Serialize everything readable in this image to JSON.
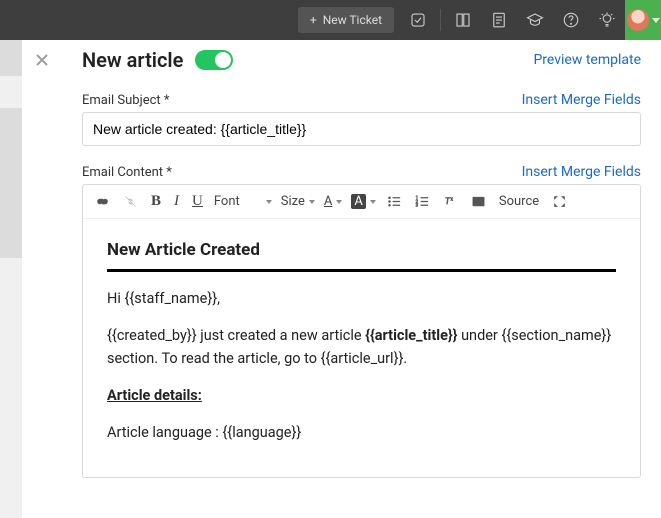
{
  "topbar": {
    "new_ticket_label": "New Ticket"
  },
  "page": {
    "title": "New article",
    "preview_link": "Preview template"
  },
  "subject": {
    "label": "Email Subject *",
    "merge_link": "Insert Merge Fields",
    "value": "New article created: {{article_title}}"
  },
  "content": {
    "label": "Email Content *",
    "merge_link": "Insert Merge Fields"
  },
  "toolbar": {
    "font_label": "Font",
    "size_label": "Size",
    "a_label": "A",
    "source_label": "Source",
    "bold": "B",
    "italic": "I",
    "underline": "U"
  },
  "body": {
    "heading": "New Article Created",
    "greeting": "Hi {{staff_name}},",
    "line1_pre": "{{created_by}} just created a new article ",
    "line1_strong": "{{article_title}}",
    "line1_post": " under {{section_name}} section. To read the article, go to {{article_url}}.",
    "details_heading": "Article details:",
    "language_line": "Article language : {{language}}"
  }
}
